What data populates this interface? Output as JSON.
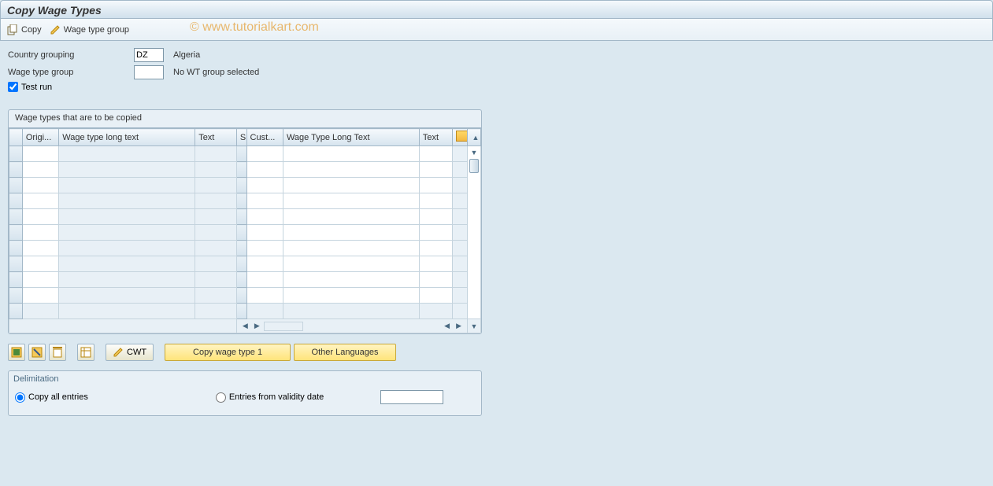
{
  "title": "Copy Wage Types",
  "toolbar": {
    "copy_label": "Copy",
    "wage_group_label": "Wage type group"
  },
  "watermark": "© www.tutorialkart.com",
  "form": {
    "country_grouping_label": "Country grouping",
    "country_grouping_value": "DZ",
    "country_grouping_desc": "Algeria",
    "wage_type_group_label": "Wage type group",
    "wage_type_group_value": "",
    "wage_type_group_desc": "No WT group selected",
    "test_run_label": "Test run",
    "test_run_checked": true
  },
  "grid": {
    "title": "Wage types that are to be copied",
    "columns": [
      "Origi...",
      "Wage type long text",
      "Text",
      "S",
      "Cust...",
      "Wage Type Long Text",
      "Text"
    ],
    "row_count": 11
  },
  "buttons": {
    "cwt": "CWT",
    "copy_wage_type_1": "Copy wage type 1",
    "other_languages": "Other Languages"
  },
  "delimitation": {
    "title": "Delimitation",
    "copy_all_label": "Copy all entries",
    "entries_from_label": "Entries from validity date",
    "selected": "copy_all",
    "date_value": ""
  }
}
